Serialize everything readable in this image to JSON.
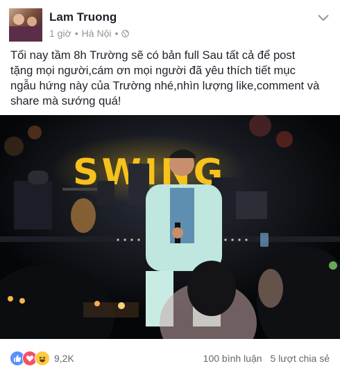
{
  "post": {
    "author": "Lam Truong",
    "time": "1 giờ",
    "separator": "•",
    "location": "Hà Nội",
    "separator2": "•",
    "text": "Tối nay tầm 8h Trường sẽ có bản full Sau tất cả để post\ntặng mọi người,cám ơn mọi người đã yêu thích tiết mục\nngẫu hứng này của Trường nhé,nhìn lượng like,comment và\nshare mà sướng quá!",
    "photo_sign": "SWING"
  },
  "icons": [
    "avatar",
    "globe-icon",
    "chevron-down-icon",
    "like-reaction-icon",
    "love-reaction-icon",
    "haha-reaction-icon"
  ],
  "footer": {
    "reaction_count": "9,2K",
    "comments": "100 bình luận",
    "shares": "5 lượt chia sẻ"
  },
  "colors": {
    "like": "#5890ff",
    "love": "#f25268",
    "haha": "#fccb43",
    "sign": "#f6c21b"
  }
}
